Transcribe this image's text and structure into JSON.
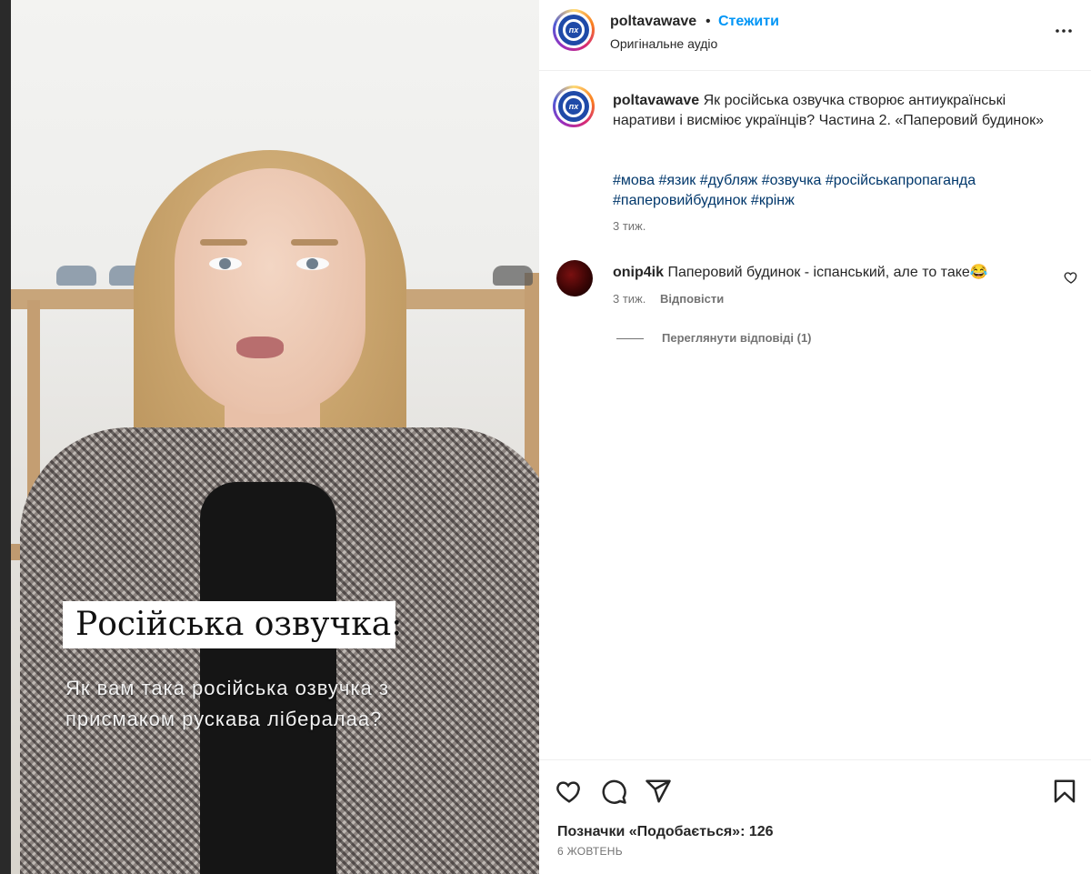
{
  "media": {
    "overlay_title": "Російська озвучка:",
    "overlay_subtitle": "Як вам така російська озвучка з присмаком рускава лібералаа?"
  },
  "header": {
    "username": "poltavawave",
    "separator": "•",
    "follow_label": "Стежити",
    "audio_label": "Оригінальне аудіо",
    "avatar_text": "пх",
    "more_icon": "more-horizontal-icon"
  },
  "caption": {
    "username": "poltavawave",
    "text": "Як російська озвучка створює антиукраїнські наративи і висміює українців? Частина 2. «Паперовий будинок»",
    "hashtags": "#мова #язик #дубляж #озвучка #російськапропаганда #паперовийбудинок #крінж",
    "time": "3 тиж."
  },
  "comments": [
    {
      "username": "onip4ik",
      "text": "Паперовий будинок - іспанський, але то таке😂",
      "time": "3 тиж.",
      "reply_label": "Відповісти",
      "view_replies": "Переглянути відповіді (1)"
    }
  ],
  "actions": {
    "icons": [
      "heart-icon",
      "comment-icon",
      "share-icon",
      "bookmark-icon"
    ],
    "likes": "Позначки «Подобається»: 126",
    "date": "6 ЖОВТЕНЬ"
  },
  "colors": {
    "link": "#0095f6",
    "hashtag": "#00376b",
    "text": "#262626",
    "muted": "#737373"
  }
}
